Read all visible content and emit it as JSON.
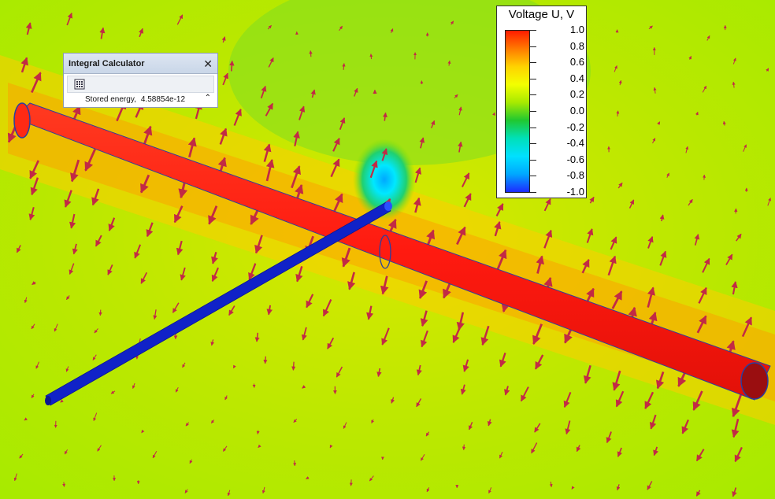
{
  "colors": {
    "field_background": "#b6ea0a",
    "positive_conductor": "#ff1a10",
    "negative_conductor": "#1022c8",
    "field_arrows": "#c22a45",
    "legend_gradient": [
      "#ff1c00",
      "#ff7a00",
      "#ffd200",
      "#f3ff00",
      "#a8ea00",
      "#20c830",
      "#00e0b8",
      "#00e0ff",
      "#00a8ff",
      "#1e2aff"
    ]
  },
  "integral_calculator": {
    "title": "Integral Calculator",
    "close_icon": "close-icon",
    "toolbar_icon": "calculator-grid-icon",
    "row_label": "Stored energy,",
    "row_value": "4.58854e-12",
    "scroll_icon": "chevron-up-icon"
  },
  "legend": {
    "title": "Voltage U, V",
    "ticks": [
      "1.0",
      "0.8",
      "0.6",
      "0.4",
      "0.2",
      "0.0",
      "-0.2",
      "-0.4",
      "-0.6",
      "-0.8",
      "-1.0"
    ]
  }
}
